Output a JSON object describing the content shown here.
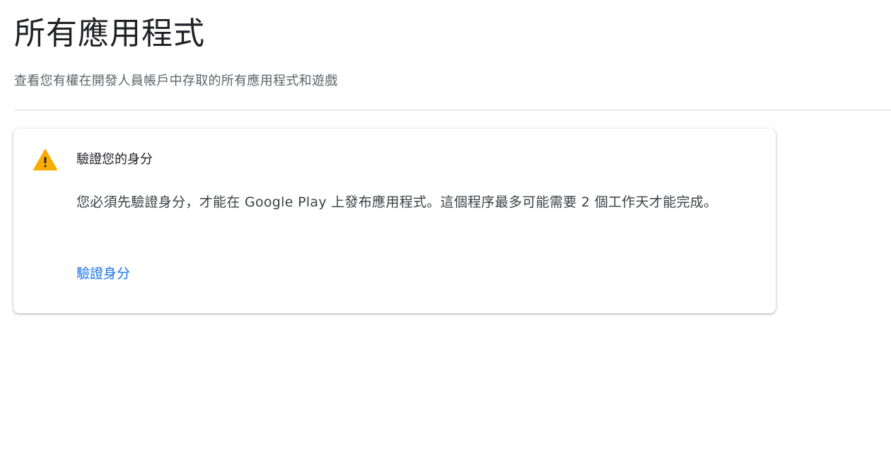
{
  "header": {
    "title": "所有應用程式",
    "subtitle": "查看您有權在開發人員帳戶中存取的所有應用程式和遊戲"
  },
  "verify_card": {
    "icon": "warning-icon",
    "icon_color": "#f9ab00",
    "title": "驗證您的身分",
    "message": "您必須先驗證身分，才能在 Google Play 上發布應用程式。這個程序最多可能需要 2 個工作天才能完成。",
    "link_label": "驗證身分",
    "link_color": "#1a73e8"
  }
}
